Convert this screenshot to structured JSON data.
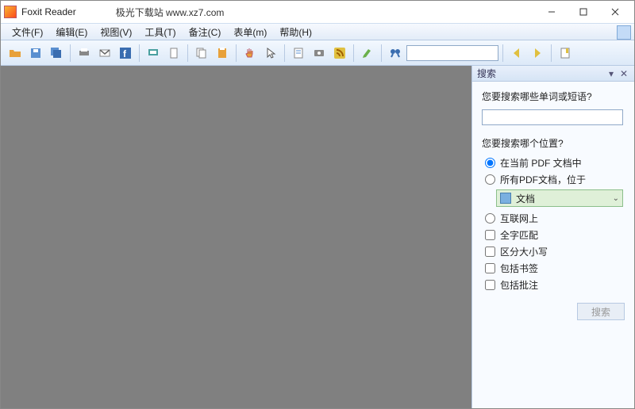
{
  "titlebar": {
    "app_name": "Foxit Reader",
    "subtitle": "极光下载站 www.xz7.com"
  },
  "menu": {
    "items": [
      "文件(F)",
      "编辑(E)",
      "视图(V)",
      "工具(T)",
      "备注(C)",
      "表单(m)",
      "帮助(H)"
    ]
  },
  "toolbar": {
    "search_value": ""
  },
  "sidepanel": {
    "title": "搜索",
    "q_label": "您要搜索哪些单词或短语?",
    "q_value": "",
    "where_label": "您要搜索哪个位置?",
    "radios": {
      "current_pdf": "在当前 PDF 文档中",
      "all_pdf": "所有PDF文档，位于"
    },
    "folder_text": "文档",
    "checks": {
      "internet": "互联网上",
      "whole_word": "全字匹配",
      "case": "区分大小写",
      "bookmarks": "包括书签",
      "annotations": "包括批注"
    },
    "search_button": "搜索"
  }
}
